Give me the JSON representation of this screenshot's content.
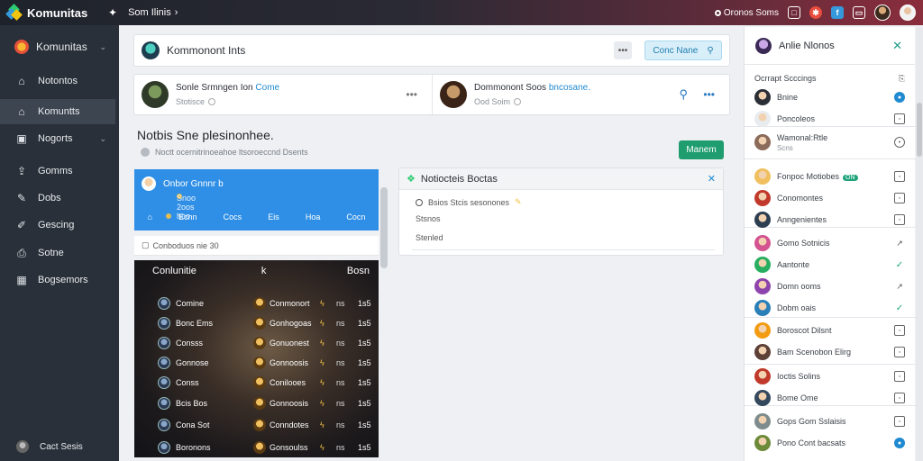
{
  "topbar": {
    "brand": "Komunitas",
    "menu_label": "Som Ilinis",
    "status_text": "Oronos Soms",
    "colors": {
      "accent_red": "#e74c3c",
      "accent_blue": "#3498db"
    }
  },
  "sidebar": {
    "header": "Komunitas",
    "items": [
      {
        "label": "Notontos",
        "icon": "home-icon"
      },
      {
        "label": "Komuntts",
        "icon": "home-icon"
      },
      {
        "label": "Nogorts",
        "icon": "report-icon"
      },
      {
        "label": "Gomms",
        "icon": "share-icon"
      },
      {
        "label": "Dobs",
        "icon": "pencil-icon"
      },
      {
        "label": "Gescing",
        "icon": "edit-icon"
      },
      {
        "label": "Sotne",
        "icon": "save-icon"
      },
      {
        "label": "Bogsemors",
        "icon": "grid-icon"
      }
    ],
    "footer": "Cact Sesis"
  },
  "header_card": {
    "title": "Kommonont Ints",
    "search_button": "Conc Nane"
  },
  "posts": [
    {
      "name": "Sonle Srmngen Ion",
      "name_link": "Come",
      "sub": "Stotisce"
    },
    {
      "name": "Dommonont Soos",
      "name_link": "bncosane.",
      "sub": "Ood Soim"
    }
  ],
  "notice": {
    "title": "Notbis Sne plesinonhee.",
    "subtitle": "Noctt ocernitrinoeahoe ltsoroeccnd Dsents",
    "manage_button": "Manem"
  },
  "blue_panel": {
    "name": "Onbor Gnnnr b",
    "sub": "Snoo  2oos hoo",
    "tabs": [
      "Ecnn",
      "Cocs",
      "Eis",
      "Hoa",
      "Cocn"
    ]
  },
  "search_filter": "Conboduos nie 30",
  "dark_list": {
    "header_left": "Conlunitie",
    "header_mid": "k",
    "header_right": "Bosn",
    "rows": [
      {
        "left": "Comine",
        "right": "Conmonort",
        "c1": "ns",
        "c2": "1s5"
      },
      {
        "left": "Bonc Ems",
        "right": "Gonhogoas",
        "c1": "ns",
        "c2": "1s5"
      },
      {
        "left": "Consss",
        "right": "Gonuonest",
        "c1": "ns",
        "c2": "1s5"
      },
      {
        "left": "Gonnose",
        "right": "Gonnoosis",
        "c1": "ns",
        "c2": "1s5"
      },
      {
        "left": "Conss",
        "right": "Conilooes",
        "c1": "ns",
        "c2": "1s5"
      },
      {
        "left": "Bcis Bos",
        "right": "Gonnoosis",
        "c1": "ns",
        "c2": "1s5"
      },
      {
        "left": "Cona Sot",
        "right": "Conndotes",
        "c1": "ns",
        "c2": "1s5"
      },
      {
        "left": "Boronons",
        "right": "Gonsoulss",
        "c1": "ns",
        "c2": "1s5"
      }
    ]
  },
  "notification": {
    "title": "Notiocteis Boctas",
    "lines": [
      "Bsios Stcis sesonones",
      "Stsnos",
      "Stenled"
    ]
  },
  "right_panel": {
    "title": "Anlie Nlonos",
    "section": "Ocrrapt Scccings",
    "rows": [
      {
        "label": "Bnine",
        "sub": "",
        "av": "#2b2f36",
        "act": "blue"
      },
      {
        "label": "Poncoleos",
        "sub": "",
        "av": "#e9ecef",
        "act": "box"
      },
      {
        "label": "Wamonal:Rtle",
        "sub": "Scns",
        "av": "#8b6b5a",
        "act": "round"
      },
      {
        "label": "Fonpoc Motiobes",
        "sub": "",
        "av": "#f0c060",
        "act": "box",
        "tag": "ON"
      },
      {
        "label": "Conomontes",
        "sub": "",
        "av": "#c0392b",
        "act": "box"
      },
      {
        "label": "Anngenientes",
        "sub": "",
        "av": "#2c3e50",
        "act": "box"
      },
      {
        "label": "Gomo Sotnicis",
        "sub": "",
        "av": "#d35490",
        "act": "open"
      },
      {
        "label": "Aantonte",
        "sub": "",
        "av": "#27ae60",
        "act": "check"
      },
      {
        "label": "Domn ooms",
        "sub": "",
        "av": "#8e44ad",
        "act": "open"
      },
      {
        "label": "Dobm oais",
        "sub": "",
        "av": "#2980b9",
        "act": "check"
      },
      {
        "label": "Boroscot Dilsnt",
        "sub": "",
        "av": "#f39c12",
        "act": "box"
      },
      {
        "label": "Bam Scenobon Elirg",
        "sub": "",
        "av": "#5d4037",
        "act": "box"
      },
      {
        "label": "Ioctis Solins",
        "sub": "",
        "av": "#c0392b",
        "act": "box"
      },
      {
        "label": "Bome Ome",
        "sub": "",
        "av": "#34495e",
        "act": "box"
      },
      {
        "label": "Gops Gom Sslaisis",
        "sub": "",
        "av": "#7f8c8d",
        "act": "box"
      },
      {
        "label": "Pono Cont bacsats",
        "sub": "",
        "av": "#6d8a3a",
        "act": "blue"
      }
    ]
  }
}
